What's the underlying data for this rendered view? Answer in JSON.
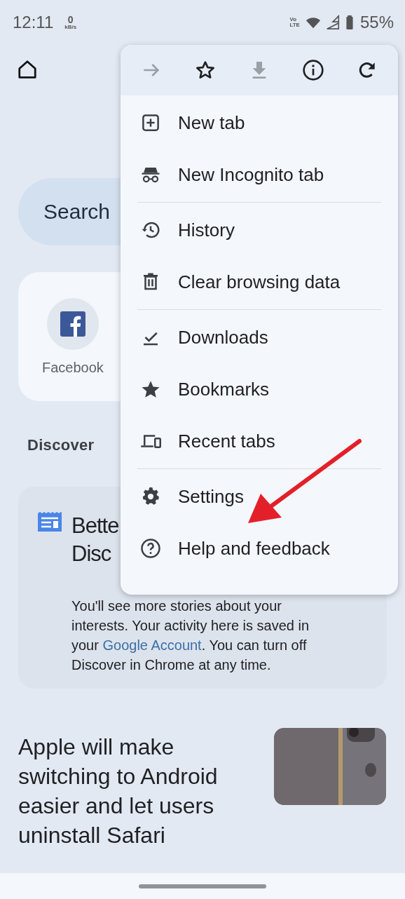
{
  "status_bar": {
    "time": "12:11",
    "speed_value": "0",
    "speed_unit": "kB/s",
    "volte_top": "Vo",
    "volte_bottom": "LTE",
    "battery": "55%"
  },
  "search": {
    "placeholder": "Search"
  },
  "shortcuts": [
    {
      "label": "Facebook"
    }
  ],
  "discover": {
    "label": "Discover"
  },
  "discover_card": {
    "title_lines": [
      "Bette",
      "Disc"
    ],
    "body": {
      "before": "You'll see more stories about your interests. Your activity here is saved in your",
      "link": "Google Account",
      "after": ". You can turn off Discover in Chrome at any time."
    }
  },
  "article": {
    "title": "Apple will make switching to Android easier and let users uninstall Safari"
  },
  "menu": {
    "toolbar": [
      {
        "kind": "forward",
        "disabled": true
      },
      {
        "kind": "star",
        "disabled": false
      },
      {
        "kind": "download",
        "disabled": true
      },
      {
        "kind": "info",
        "disabled": false
      },
      {
        "kind": "refresh",
        "disabled": false
      }
    ],
    "groups": [
      [
        {
          "kind": "new-tab",
          "label": "New tab"
        },
        {
          "kind": "incognito",
          "label": "New Incognito tab"
        }
      ],
      [
        {
          "kind": "history",
          "label": "History"
        },
        {
          "kind": "trash",
          "label": "Clear browsing data"
        }
      ],
      [
        {
          "kind": "downloads",
          "label": "Downloads"
        },
        {
          "kind": "bookmarks",
          "label": "Bookmarks"
        },
        {
          "kind": "devices",
          "label": "Recent tabs"
        }
      ],
      [
        {
          "kind": "settings",
          "label": "Settings"
        },
        {
          "kind": "help",
          "label": "Help and feedback"
        }
      ]
    ]
  }
}
